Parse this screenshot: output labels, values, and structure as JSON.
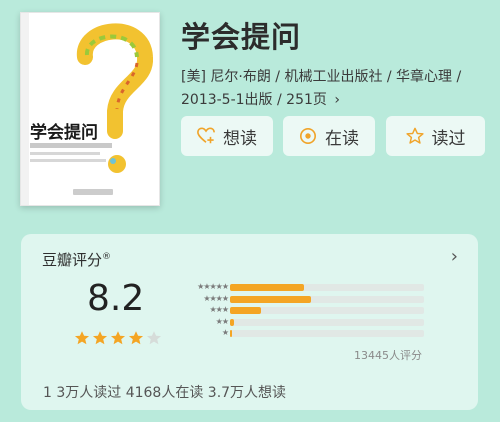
{
  "book": {
    "title": "学会提问",
    "cover_title": "学会提问",
    "meta": "[美] 尼尔·布朗 / 机械工业出版社 / 华章心理 / 2013-5-1出版 / 251页",
    "meta_chevron": "›"
  },
  "actions": {
    "want_label": "想读",
    "reading_label": "在读",
    "read_label": "读过"
  },
  "rating": {
    "label": "豆瓣评分",
    "trademark": "®",
    "score": "8.2",
    "stars_filled": 4,
    "stars_total": 5,
    "distribution": [
      {
        "stars": "★★★★★",
        "fraction": 0.38
      },
      {
        "stars": "★★★★",
        "fraction": 0.42
      },
      {
        "stars": "★★★",
        "fraction": 0.16
      },
      {
        "stars": "★★",
        "fraction": 0.02
      },
      {
        "stars": "★",
        "fraction": 0.01
      }
    ],
    "raters": "13445人评分",
    "stats": "1 3万人读过   4168人在读   3.7万人想读"
  },
  "colors": {
    "background": "#b9eadb",
    "accent": "#f4a524"
  }
}
